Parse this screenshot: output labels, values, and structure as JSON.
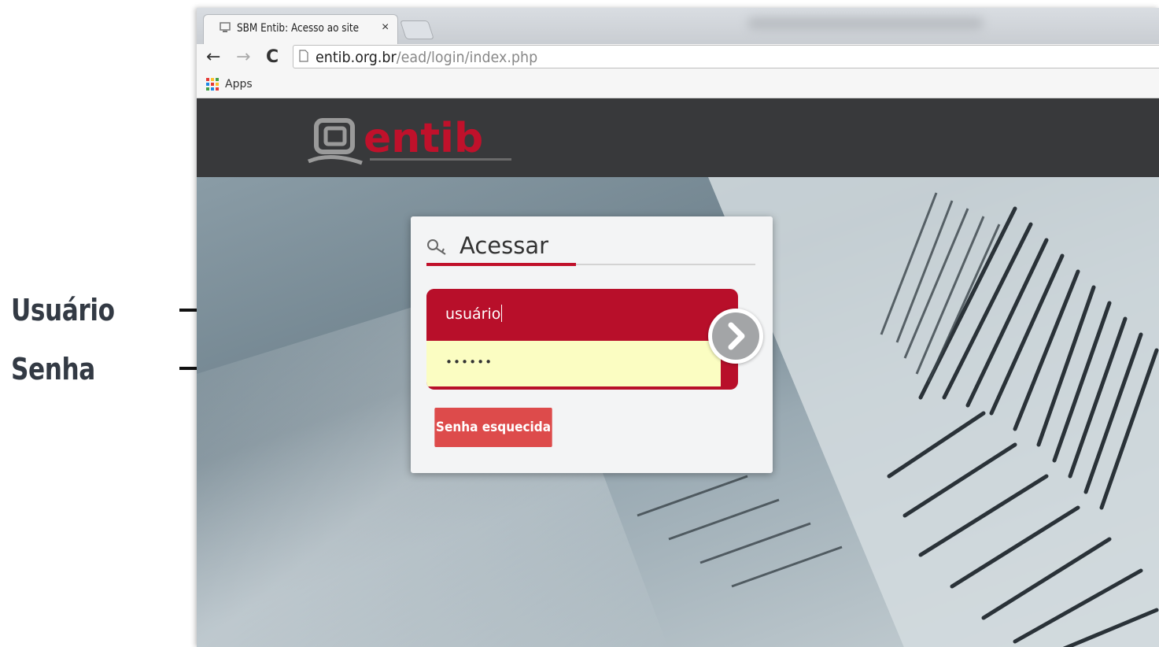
{
  "annotations": {
    "user_label": "Usuário",
    "password_label": "Senha"
  },
  "browser": {
    "tab_title": "SBM Entib: Acesso ao site",
    "tab_close": "×",
    "back": "←",
    "forward": "→",
    "reload": "C",
    "url_host": "entib.org.br",
    "url_path": "/ead/login/index.php",
    "bookmark_apps": "Apps"
  },
  "site": {
    "logo_text": "entib",
    "logo_color": "#c0112b",
    "header_color": "#38393b"
  },
  "login": {
    "title": "Acessar",
    "username_value": "usuário",
    "password_value": "••••••",
    "forgot_button": "Senha esquecida",
    "accent_color": "#b80f2a",
    "password_bg": "#fbfdc2",
    "submit_icon": "chevron-right-icon"
  }
}
